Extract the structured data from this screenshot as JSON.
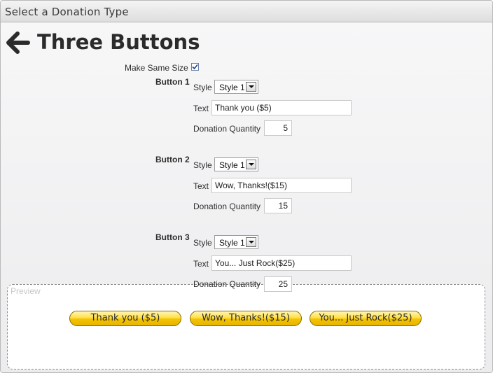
{
  "window": {
    "title": "Select a Donation Type"
  },
  "header": {
    "back_icon": "arrow-left-icon",
    "title": "Three Buttons"
  },
  "make_same_size": {
    "label": "Make Same Size",
    "checked": true
  },
  "buttons": [
    {
      "label": "Button 1",
      "style_label": "Style",
      "style_value": "Style 1",
      "text_label": "Text",
      "text_value": "Thank you ($5)",
      "qty_label": "Donation Quantity",
      "qty_value": "5"
    },
    {
      "label": "Button 2",
      "style_label": "Style",
      "style_value": "Style 1",
      "text_label": "Text",
      "text_value": "Wow, Thanks!($15)",
      "qty_label": "Donation Quantity",
      "qty_value": "15"
    },
    {
      "label": "Button 3",
      "style_label": "Style",
      "style_value": "Style 1",
      "text_label": "Text",
      "text_value": "You... Just Rock($25)",
      "qty_label": "Donation Quantity",
      "qty_value": "25"
    }
  ],
  "preview": {
    "legend": "Preview",
    "buttons": [
      "Thank you ($5)",
      "Wow, Thanks!($15)",
      "You... Just Rock($25)"
    ]
  },
  "colors": {
    "preview_button": "#ffd200",
    "preview_button_border": "#8a6c00",
    "checkbox_check": "#2b3f8a"
  }
}
